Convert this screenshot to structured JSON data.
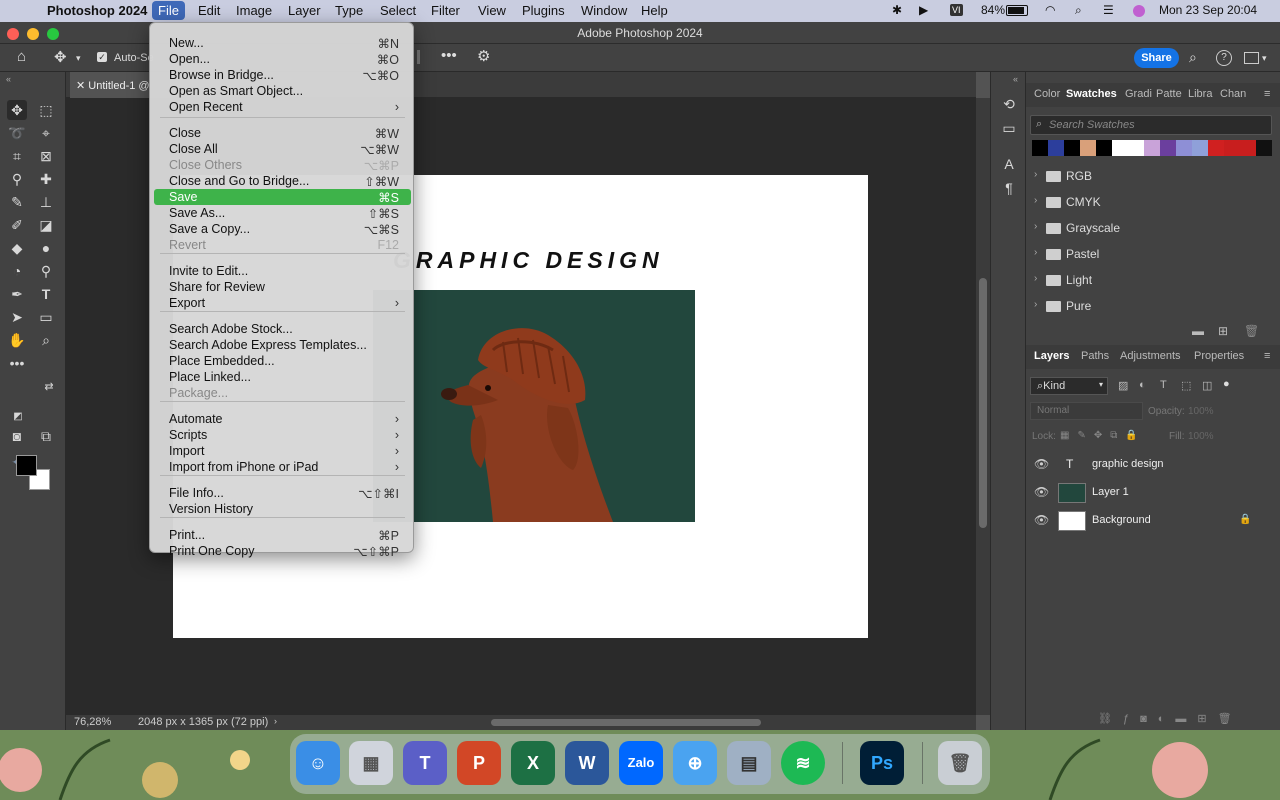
{
  "menubar": {
    "app": "Photoshop 2024",
    "items": [
      "File",
      "Edit",
      "Image",
      "Layer",
      "Type",
      "Select",
      "Filter",
      "View",
      "Plugins",
      "Window",
      "Help"
    ],
    "battery": "84%",
    "datetime": "Mon 23 Sep  20:04"
  },
  "window": {
    "title": "Adobe Photoshop 2024"
  },
  "options": {
    "auto_select": "Auto-Se",
    "share": "Share"
  },
  "document": {
    "tab": "Untitled-1 @",
    "canvas_text": "GRAPHIC DESIGN"
  },
  "status": {
    "zoom": "76,28%",
    "doc_info": "2048 px x 1365 px (72 ppi)"
  },
  "file_menu": {
    "items": [
      {
        "label": "New...",
        "shortcut": "⌘N"
      },
      {
        "label": "Open...",
        "shortcut": "⌘O"
      },
      {
        "label": "Browse in Bridge...",
        "shortcut": "⌥⌘O"
      },
      {
        "label": "Open as Smart Object...",
        "shortcut": ""
      },
      {
        "label": "Open Recent",
        "shortcut": "›"
      },
      {
        "label": "Close",
        "shortcut": "⌘W"
      },
      {
        "label": "Close All",
        "shortcut": "⌥⌘W"
      },
      {
        "label": "Close Others",
        "shortcut": "⌥⌘P"
      },
      {
        "label": "Close and Go to Bridge...",
        "shortcut": "⇧⌘W"
      },
      {
        "label": "Save",
        "shortcut": "⌘S"
      },
      {
        "label": "Save As...",
        "shortcut": "⇧⌘S"
      },
      {
        "label": "Save a Copy...",
        "shortcut": "⌥⌘S"
      },
      {
        "label": "Revert",
        "shortcut": "F12"
      },
      {
        "label": "Invite to Edit...",
        "shortcut": ""
      },
      {
        "label": "Share for Review",
        "shortcut": ""
      },
      {
        "label": "Export",
        "shortcut": "›"
      },
      {
        "label": "Search Adobe Stock...",
        "shortcut": ""
      },
      {
        "label": "Search Adobe Express Templates...",
        "shortcut": ""
      },
      {
        "label": "Place Embedded...",
        "shortcut": ""
      },
      {
        "label": "Place Linked...",
        "shortcut": ""
      },
      {
        "label": "Package...",
        "shortcut": ""
      },
      {
        "label": "Automate",
        "shortcut": "›"
      },
      {
        "label": "Scripts",
        "shortcut": "›"
      },
      {
        "label": "Import",
        "shortcut": "›"
      },
      {
        "label": "Import from iPhone or iPad",
        "shortcut": "›"
      },
      {
        "label": "File Info...",
        "shortcut": "⌥⇧⌘I"
      },
      {
        "label": "Version History",
        "shortcut": ""
      },
      {
        "label": "Print...",
        "shortcut": "⌘P"
      },
      {
        "label": "Print One Copy",
        "shortcut": "⌥⇧⌘P"
      }
    ]
  },
  "swatches_panel": {
    "tabs": [
      "Color",
      "Swatches",
      "Gradi",
      "Patte",
      "Libra",
      "Chan"
    ],
    "search_placeholder": "Search Swatches",
    "colors": [
      "#000000",
      "#2c3e9c",
      "#000000",
      "#d9a07a",
      "#000000",
      "#ffffff",
      "#ffffff",
      "#c9a3d9",
      "#6b3f9e",
      "#8e8fd6",
      "#8fa0d9",
      "#d02020",
      "#c81e1e",
      "#c81e1e",
      "#111111"
    ],
    "folders": [
      "RGB",
      "CMYK",
      "Grayscale",
      "Pastel",
      "Light",
      "Pure"
    ]
  },
  "layers_panel": {
    "tabs": [
      "Layers",
      "Paths",
      "Adjustments",
      "Properties"
    ],
    "kind": "Kind",
    "blend": "Normal",
    "opacity_label": "Opacity:",
    "opacity": "100%",
    "lock_label": "Lock:",
    "fill_label": "Fill:",
    "fill": "100%",
    "layers": [
      {
        "name": "graphic design",
        "type": "text"
      },
      {
        "name": "Layer 1",
        "type": "image"
      },
      {
        "name": "Background",
        "type": "fill"
      }
    ]
  },
  "dock": {
    "apps": [
      "Finder",
      "Launchpad",
      "Teams",
      "PowerPoint",
      "Excel",
      "Word",
      "Zalo",
      "Safari",
      "Preview",
      "Spotify",
      "Photoshop",
      "Trash"
    ],
    "labels": [
      "",
      "",
      "",
      "P",
      "X",
      "W",
      "Zalo",
      "",
      "",
      "",
      "Ps",
      ""
    ]
  }
}
